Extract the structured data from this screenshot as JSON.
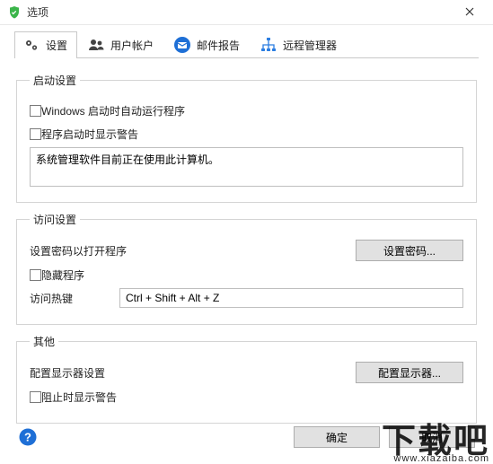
{
  "window": {
    "title": "选项"
  },
  "tabs": {
    "settings": "设置",
    "accounts": "用户帐户",
    "mail": "邮件报告",
    "remote": "远程管理器"
  },
  "groups": {
    "startup": {
      "legend": "启动设置",
      "autorun": "Windows 启动时自动运行程序",
      "show_warn_on_start": "程序启动时显示警告",
      "warn_text": "系统管理软件目前正在使用此计算机。"
    },
    "access": {
      "legend": "访问设置",
      "set_password_label": "设置密码以打开程序",
      "set_password_btn": "设置密码...",
      "hide_program": "隐藏程序",
      "hotkey_label": "访问热键",
      "hotkey_value": "Ctrl + Shift + Alt + Z"
    },
    "other": {
      "legend": "其他",
      "config_monitor_label": "配置显示器设置",
      "config_monitor_btn": "配置显示器...",
      "block_warn": "阻止时显示警告"
    }
  },
  "buttons": {
    "ok": "确定",
    "cancel": "取消"
  },
  "watermark": {
    "text": "下载吧",
    "url": "www.xiazaiba.com"
  }
}
